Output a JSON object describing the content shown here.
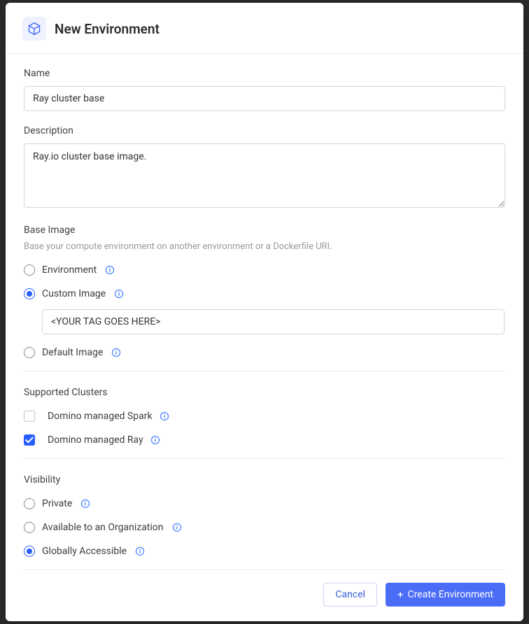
{
  "dialog": {
    "title": "New Environment"
  },
  "fields": {
    "name": {
      "label": "Name",
      "value": "Ray cluster base"
    },
    "description": {
      "label": "Description",
      "value": "Ray.io cluster base image."
    }
  },
  "baseImage": {
    "heading": "Base Image",
    "helper": "Base your compute environment on another environment or a Dockerfile URI.",
    "options": {
      "environment": "Environment",
      "custom": "Custom Image",
      "default": "Default Image"
    },
    "customValue": "<YOUR TAG GOES HERE>"
  },
  "clusters": {
    "heading": "Supported Clusters",
    "spark": "Domino managed Spark",
    "ray": "Domino managed Ray"
  },
  "visibility": {
    "heading": "Visibility",
    "options": {
      "private": "Private",
      "org": "Available to an Organization",
      "global": "Globally Accessible"
    }
  },
  "footer": {
    "cancel": "Cancel",
    "create": "Create Environment"
  }
}
